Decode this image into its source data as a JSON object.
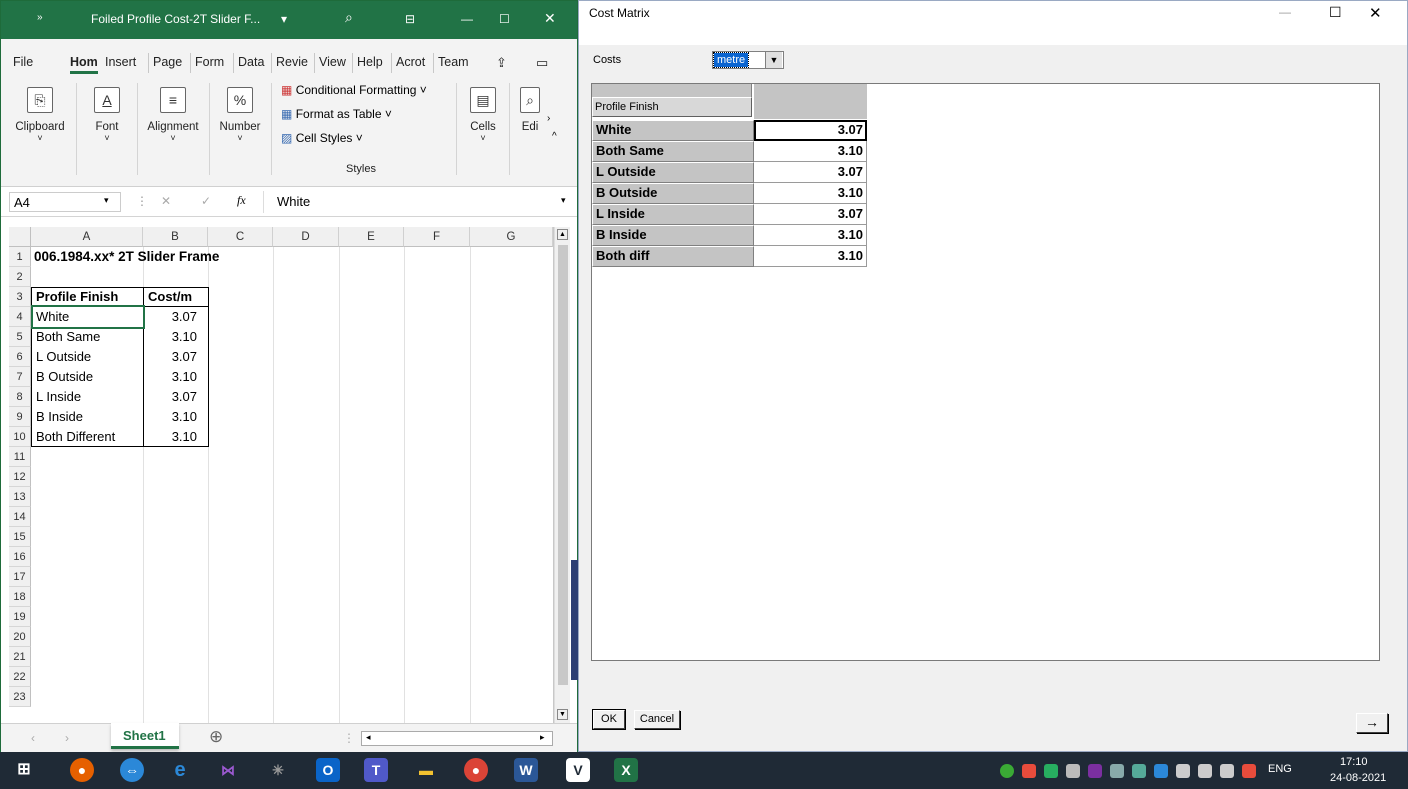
{
  "excel": {
    "title": "Foiled Profile Cost-2T Slider F...",
    "title_arrow": "▾",
    "tabs": [
      "File",
      "Hom",
      "Insert",
      "Page",
      "Form",
      "Data",
      "Revie",
      "View",
      "Help",
      "Acrot",
      "Team"
    ],
    "ribbon_groups": {
      "clipboard": "Clipboard",
      "font": "Font",
      "alignment": "Alignment",
      "number": "Number",
      "cond_format": "Conditional Formatting ˅",
      "format_table": "Format as Table ˅",
      "cell_styles": "Cell Styles ˅",
      "styles": "Styles",
      "cells": "Cells",
      "editing": "Edi"
    },
    "name_box": "A4",
    "formula": "White",
    "columns": [
      "A",
      "B",
      "C",
      "D",
      "E",
      "F",
      "G"
    ],
    "rows": [
      "1",
      "2",
      "3",
      "4",
      "5",
      "6",
      "7",
      "8",
      "9",
      "10",
      "11",
      "12",
      "13",
      "14",
      "15",
      "16",
      "17",
      "18",
      "19",
      "20",
      "21",
      "22",
      "23"
    ],
    "title_cell": "006.1984.xx* 2T Slider Frame",
    "table_headers": [
      "Profile Finish",
      "Cost/m"
    ],
    "table_rows": [
      {
        "finish": "White",
        "cost": "3.07"
      },
      {
        "finish": "Both Same",
        "cost": "3.10"
      },
      {
        "finish": "L Outside",
        "cost": "3.07"
      },
      {
        "finish": "B Outside",
        "cost": "3.10"
      },
      {
        "finish": "L Inside",
        "cost": "3.07"
      },
      {
        "finish": "B Inside",
        "cost": "3.10"
      },
      {
        "finish": "Both Different",
        "cost": "3.10"
      }
    ],
    "sheet_tab": "Sheet1"
  },
  "dialog": {
    "title": "Cost Matrix",
    "costs_label": "Costs",
    "costs_value": "metre",
    "header": "Profile Finish",
    "rows": [
      {
        "label": "White",
        "value": "3.07"
      },
      {
        "label": "Both Same",
        "value": "3.10"
      },
      {
        "label": "L Outside",
        "value": "3.07"
      },
      {
        "label": "B Outside",
        "value": "3.10"
      },
      {
        "label": "L Inside",
        "value": "3.07"
      },
      {
        "label": "B Inside",
        "value": "3.10"
      },
      {
        "label": "Both diff",
        "value": "3.10"
      }
    ],
    "ok": "OK",
    "cancel": "Cancel",
    "arrow": "→"
  },
  "taskbar": {
    "lang": "ENG",
    "time": "17:10",
    "date": "24-08-2021"
  },
  "colors": {
    "excel_green": "#217346",
    "taskbar": "#1f2a36",
    "header_grey": "#c4c4c4"
  }
}
